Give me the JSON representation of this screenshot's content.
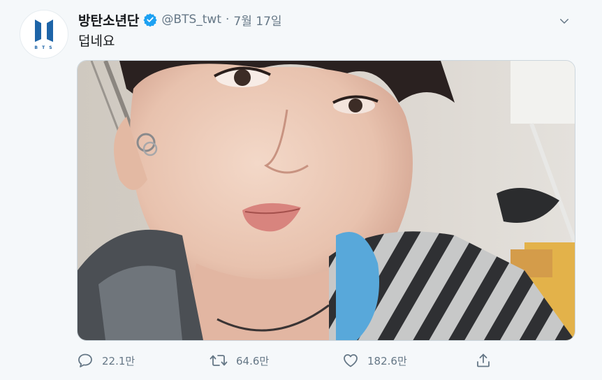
{
  "tweet": {
    "display_name": "방탄소년단",
    "handle": "@BTS_twt",
    "separator": "·",
    "date": "7월 17일",
    "text": "덥네요",
    "avatar_text": "B T S",
    "avatar_icon": "bts-logo-icon",
    "verified_icon": "verified-badge-icon",
    "more_icon": "chevron-down-icon",
    "colors": {
      "accent": "#1da1f2",
      "logo_blue": "#1d64a8",
      "muted": "#657786"
    }
  },
  "actions": {
    "reply": {
      "icon": "reply-icon",
      "count": "22.1만"
    },
    "retweet": {
      "icon": "retweet-icon",
      "count": "64.6만"
    },
    "like": {
      "icon": "heart-icon",
      "count": "182.6만"
    },
    "share": {
      "icon": "share-icon"
    }
  }
}
